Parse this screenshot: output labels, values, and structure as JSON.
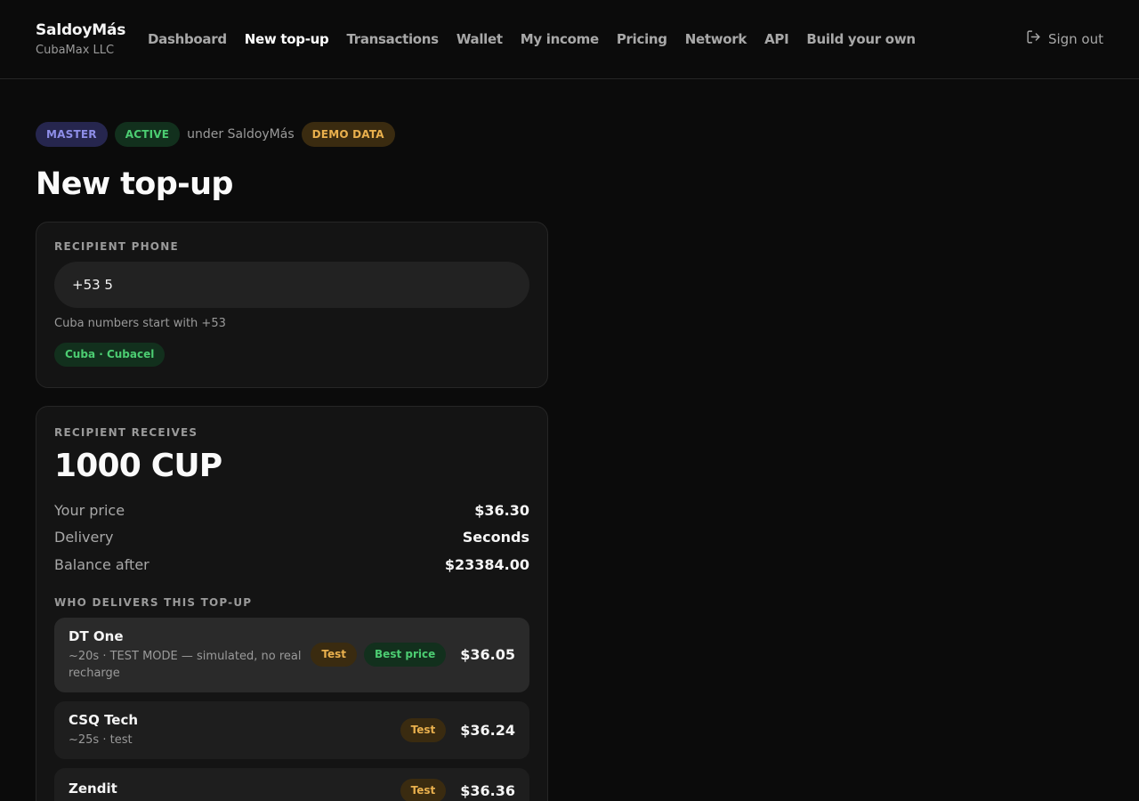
{
  "brand": {
    "name": "SaldoyMás",
    "company": "CubaMax LLC"
  },
  "nav": {
    "items": [
      {
        "label": "Dashboard",
        "active": false
      },
      {
        "label": "New top-up",
        "active": true
      },
      {
        "label": "Transactions",
        "active": false
      },
      {
        "label": "Wallet",
        "active": false
      },
      {
        "label": "My income",
        "active": false
      },
      {
        "label": "Pricing",
        "active": false
      },
      {
        "label": "Network",
        "active": false
      },
      {
        "label": "API",
        "active": false
      },
      {
        "label": "Build your own",
        "active": false
      }
    ],
    "signout_label": "Sign out"
  },
  "status": {
    "role": "MASTER",
    "state": "ACTIVE",
    "under": "under SaldoyMás",
    "demo": "DEMO DATA"
  },
  "page_title": "New top-up",
  "phone": {
    "label": "RECIPIENT PHONE",
    "value": "+53 5",
    "hint": "Cuba numbers start with +53",
    "carrier": "Cuba · Cubacel"
  },
  "receive": {
    "label": "RECIPIENT RECEIVES",
    "amount": "1000 CUP",
    "rows": [
      {
        "key": "Your price",
        "value": "$36.30"
      },
      {
        "key": "Delivery",
        "value": "Seconds"
      },
      {
        "key": "Balance after",
        "value": "$23384.00"
      }
    ],
    "providers_label": "WHO DELIVERS THIS TOP-UP",
    "providers": [
      {
        "name": "DT One",
        "meta": "~20s · TEST MODE — simulated, no real recharge",
        "test_tag": "Test",
        "best_tag": "Best price",
        "price": "$36.05"
      },
      {
        "name": "CSQ Tech",
        "meta": "~25s · test",
        "test_tag": "Test",
        "price": "$36.24"
      },
      {
        "name": "Zendit",
        "meta": "",
        "test_tag": "Test",
        "price": "$36.36"
      }
    ]
  },
  "colors": {
    "background": "#0b0b0b",
    "card": "#141414",
    "green": "#4ccd72",
    "amber": "#e9b04d",
    "indigo": "#8e8ee8"
  }
}
